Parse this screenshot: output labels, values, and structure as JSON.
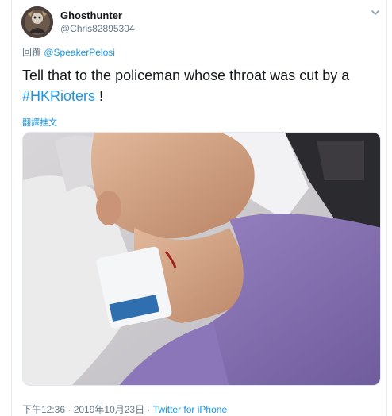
{
  "tweet": {
    "display_name": "Ghosthunter",
    "handle": "@Chris82895304",
    "reply_prefix": "回覆",
    "reply_mention": "@SpeakerPelosi",
    "text_before": "Tell that to the policeman whose throat was cut by a ",
    "hashtag": "#HKRioters",
    "text_after": " !",
    "translate_label": "翻譯推文",
    "timestamp": "下午12:36 · 2019年10月23日 · ",
    "source": "Twitter for iPhone"
  },
  "icons": {
    "avatar": "avatar-image",
    "caret": "chevron-down-icon",
    "media": "tweet-photo"
  },
  "colors": {
    "link": "#1b95e0",
    "secondary_text": "#657786",
    "primary_text": "#14171a"
  }
}
